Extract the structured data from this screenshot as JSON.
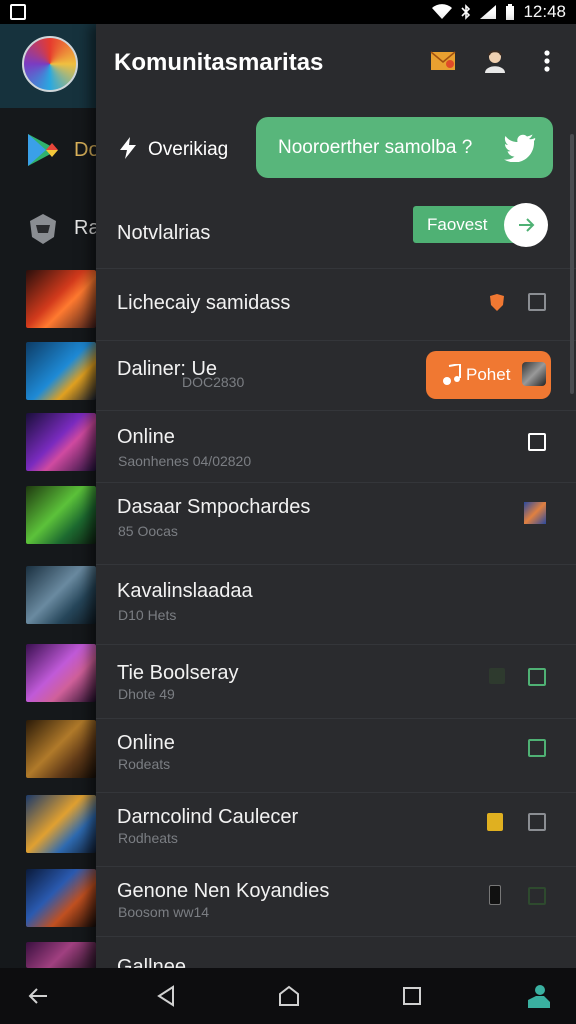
{
  "status_bar": {
    "time": "12:48"
  },
  "header": {
    "title": "Komunitasmaritas"
  },
  "left_panel": {
    "labels": [
      "Do",
      "Ra"
    ]
  },
  "action_row": {
    "label": "Overikiag"
  },
  "green_pill": {
    "label": "Nooroerther samolba ?"
  },
  "notifications_row": {
    "label": "Notvlalrias",
    "button": "Faovest"
  },
  "rows": [
    {
      "title": "Lichecaiy samidass",
      "subtitle": ""
    },
    {
      "title": "Daliner: Ue",
      "subtitle": "DOC2830",
      "button": "Pohet"
    },
    {
      "title": "Online",
      "subtitle": "Saonhenes 04/02820"
    },
    {
      "title": "Dasaar Smpochardes",
      "subtitle": "85 Oocas"
    },
    {
      "title": "Kavalinslaadaa",
      "subtitle": "D10 Hets"
    },
    {
      "title": "Tie Boolseray",
      "subtitle": "Dhote 49"
    },
    {
      "title": "Online",
      "subtitle": "Rodeats"
    },
    {
      "title": "Darncolind Caulecer",
      "subtitle": "Rodheats"
    },
    {
      "title": "Genone Nen Koyandies",
      "subtitle": "Boosom ww14"
    },
    {
      "title": "Gallnee",
      "subtitle": ""
    }
  ],
  "colors": {
    "accent_green": "#58b67b",
    "accent_orange": "#f07832",
    "panel_bg": "#2a2b2e"
  }
}
